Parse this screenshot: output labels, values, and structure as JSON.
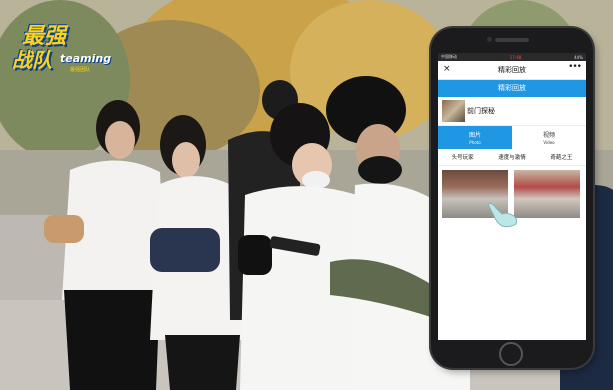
{
  "logo": {
    "top": "最强",
    "bottom": "战队",
    "english": "teaming",
    "sub": "最强团队"
  },
  "phone": {
    "status": {
      "left": "中国移动",
      "time": "17:48",
      "right": "44%"
    },
    "nav": {
      "close": "×",
      "title": "精彩回放",
      "more": "•••"
    },
    "banner": "精彩回放",
    "album": {
      "title": "前门探秘"
    },
    "tabs": [
      {
        "label": "图片",
        "en": "Photo",
        "active": true
      },
      {
        "label": "视频",
        "en": "Video",
        "active": false
      }
    ],
    "subtabs": [
      "头号玩家",
      "速度与激情",
      "奇葩之王"
    ]
  },
  "colors": {
    "accent": "#1f97e3",
    "logo_yellow": "#ffd21a",
    "logo_blue": "#0b3f8f"
  }
}
